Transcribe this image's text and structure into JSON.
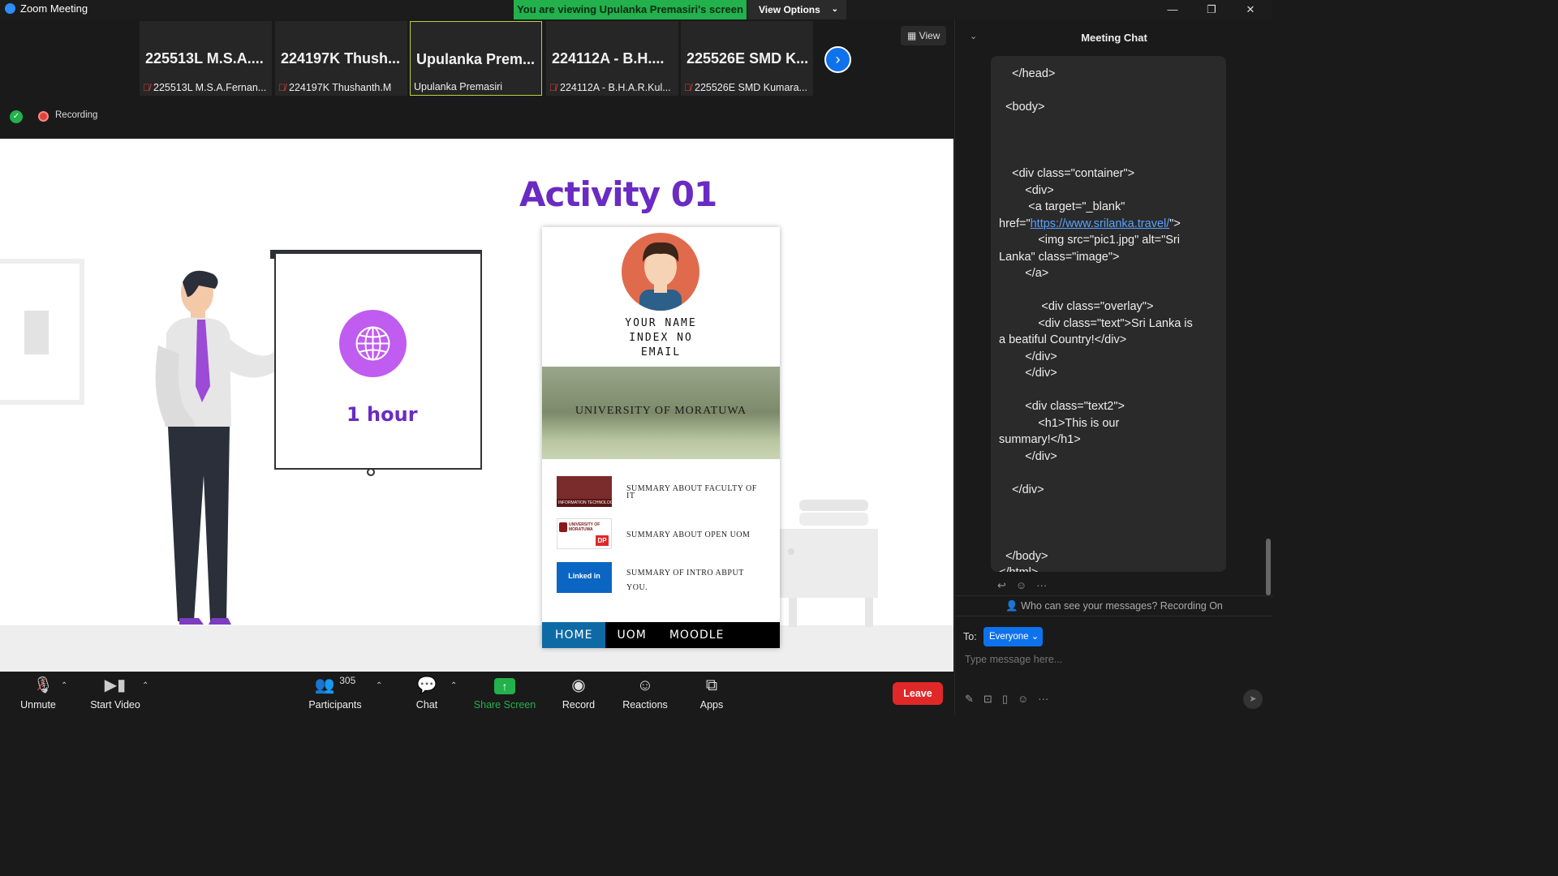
{
  "window": {
    "title": "Zoom Meeting",
    "viewing_banner": "You are viewing Upulanka Premasiri's screen",
    "view_options": "View Options"
  },
  "thumbnails": [
    {
      "big": "225513L  M.S.A....",
      "small": "225513L M.S.A.Fernan...",
      "muted": true
    },
    {
      "big": "224197K  Thush...",
      "small": "224197K Thushanth.M",
      "muted": true
    },
    {
      "big": "Upulanka  Prem...",
      "small": "Upulanka Premasiri",
      "muted": false
    },
    {
      "big": "224112A - B.H....",
      "small": "224112A - B.H.A.R.Kul...",
      "muted": true
    },
    {
      "big": "225526E SMD K...",
      "small": "225526E SMD Kumara...",
      "muted": true
    }
  ],
  "view_button": "View",
  "recording_label": "Recording",
  "slide": {
    "title": "Activity 01",
    "duration": "1 hour",
    "card": {
      "lines": [
        "YOUR NAME",
        "INDEX NO",
        "EMAIL"
      ],
      "campus_label": "UNIVERSITY OF MORATUWA",
      "rows": [
        {
          "text": "SUMMARY ABOUT FACULTY OF IT",
          "img_label": "INFORMATION TECHNOLOGY"
        },
        {
          "text": "SUMMARY ABOUT OPEN UOM",
          "img_label": "UNIVERSITY OF MORATUWA"
        },
        {
          "text": "SUMMARY OF INTRO ABPUT YOU.",
          "img_label": "Linked in"
        }
      ],
      "nav": [
        "HOME",
        "UOM",
        "MOODLE"
      ]
    }
  },
  "toolbar": {
    "unmute": "Unmute",
    "start_video": "Start Video",
    "participants": "Participants",
    "participants_count": "305",
    "chat": "Chat",
    "share_screen": "Share Screen",
    "record": "Record",
    "reactions": "Reactions",
    "apps": "Apps",
    "leave": "Leave"
  },
  "chat": {
    "title": "Meeting Chat",
    "message_lines": [
      "    </head>",
      "",
      "  <body>",
      "",
      "",
      "",
      "    <div class=\"container\">",
      "        <div>",
      "         <a target=\"_blank\"",
      "href=\"",
      "            <img src=\"pic1.jpg\" alt=\"Sri",
      "Lanka\" class=\"image\">",
      "        </a>",
      "",
      "             <div class=\"overlay\">",
      "            <div class=\"text\">Sri Lanka is",
      "a beatiful Country!</div>",
      "        </div>",
      "        </div>",
      "",
      "        <div class=\"text2\">",
      "            <h1>This is our",
      "summary!</h1>",
      "        </div>",
      "",
      "    </div>",
      "",
      "",
      "",
      "  </body>",
      "</html>"
    ],
    "link_text": "https://www.srilanka.travel/",
    "link_suffix": "\">",
    "who_can_see": "Who can see your messages? Recording On",
    "to_label": "To:",
    "to_value": "Everyone",
    "input_placeholder": "Type message here..."
  },
  "colors": {
    "accent_green": "#22b14c",
    "accent_blue": "#0e72ed",
    "leave_red": "#e02828",
    "slide_purple": "#6a2bc3"
  }
}
